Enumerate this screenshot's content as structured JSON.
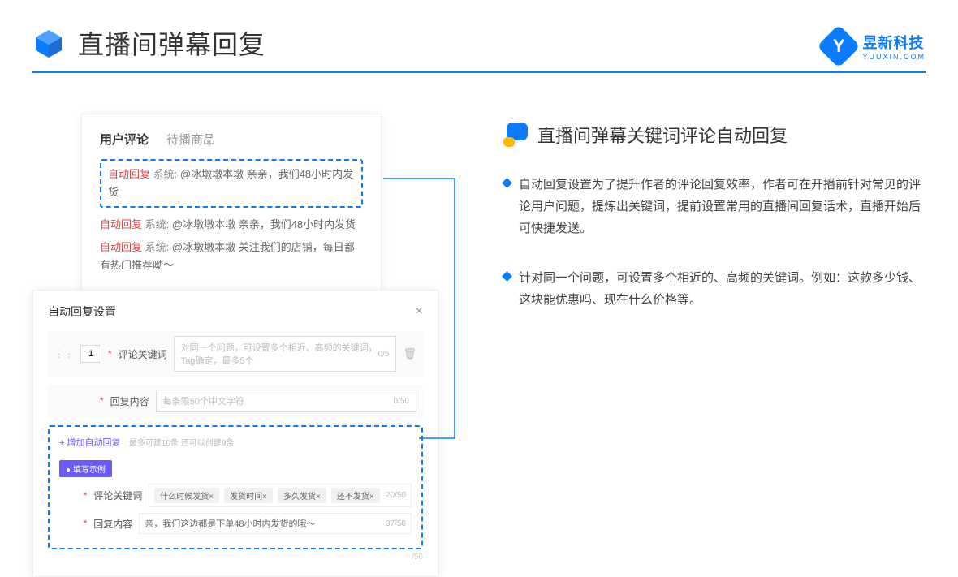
{
  "header": {
    "title": "直播间弹幕回复"
  },
  "logo": {
    "text": "昱新科技",
    "sub": "YUUXIN.COM",
    "badge": "Y"
  },
  "comments": {
    "tab_active": "用户评论",
    "tab_inactive": "待播商品",
    "highlighted": {
      "auto": "自动回复",
      "sys": "系统:",
      "text": "@冰墩墩本墩 亲亲，我们48小时内发货"
    },
    "line2": {
      "auto": "自动回复",
      "sys": "系统:",
      "text": "@冰墩墩本墩 亲亲，我们48小时内发货"
    },
    "line3": {
      "auto": "自动回复",
      "sys": "系统:",
      "text": "@冰墩墩本墩 关注我们的店铺，每日都有热门推荐呦～"
    }
  },
  "settings": {
    "title": "自动回复设置",
    "num": "1",
    "kw_label": "评论关键词",
    "kw_placeholder": "对同一个问题，可设置多个相近、高频的关键词，Tag确定，最多5个",
    "kw_count": "0/5",
    "content_label": "回复内容",
    "content_placeholder": "每条限50个中文字符",
    "content_count": "0/50",
    "add_link": "+ 增加自动回复",
    "add_hint": "最多可建10条 还可以创建9条",
    "example_badge": "● 填写示例",
    "ex_kw_label": "评论关键词",
    "ex_tags": [
      "什么时候发货×",
      "发货时间×",
      "多久发货×",
      "还不发货×"
    ],
    "ex_kw_count": "20/50",
    "ex_content_label": "回复内容",
    "ex_content_text": "亲，我们这边都是下单48小时内发货的哦～",
    "ex_content_count": "37/50",
    "trailing_count": "/50"
  },
  "right": {
    "section_title": "直播间弹幕关键词评论自动回复",
    "bullet1": "自动回复设置为了提升作者的评论回复效率，作者可在开播前针对常见的评论用户问题，提炼出关键词，提前设置常用的直播间回复话术，直播开始后可快捷发送。",
    "bullet2": "针对同一个问题，可设置多个相近的、高频的关键词。例如：这款多少钱、这块能优惠吗、现在什么价格等。"
  }
}
